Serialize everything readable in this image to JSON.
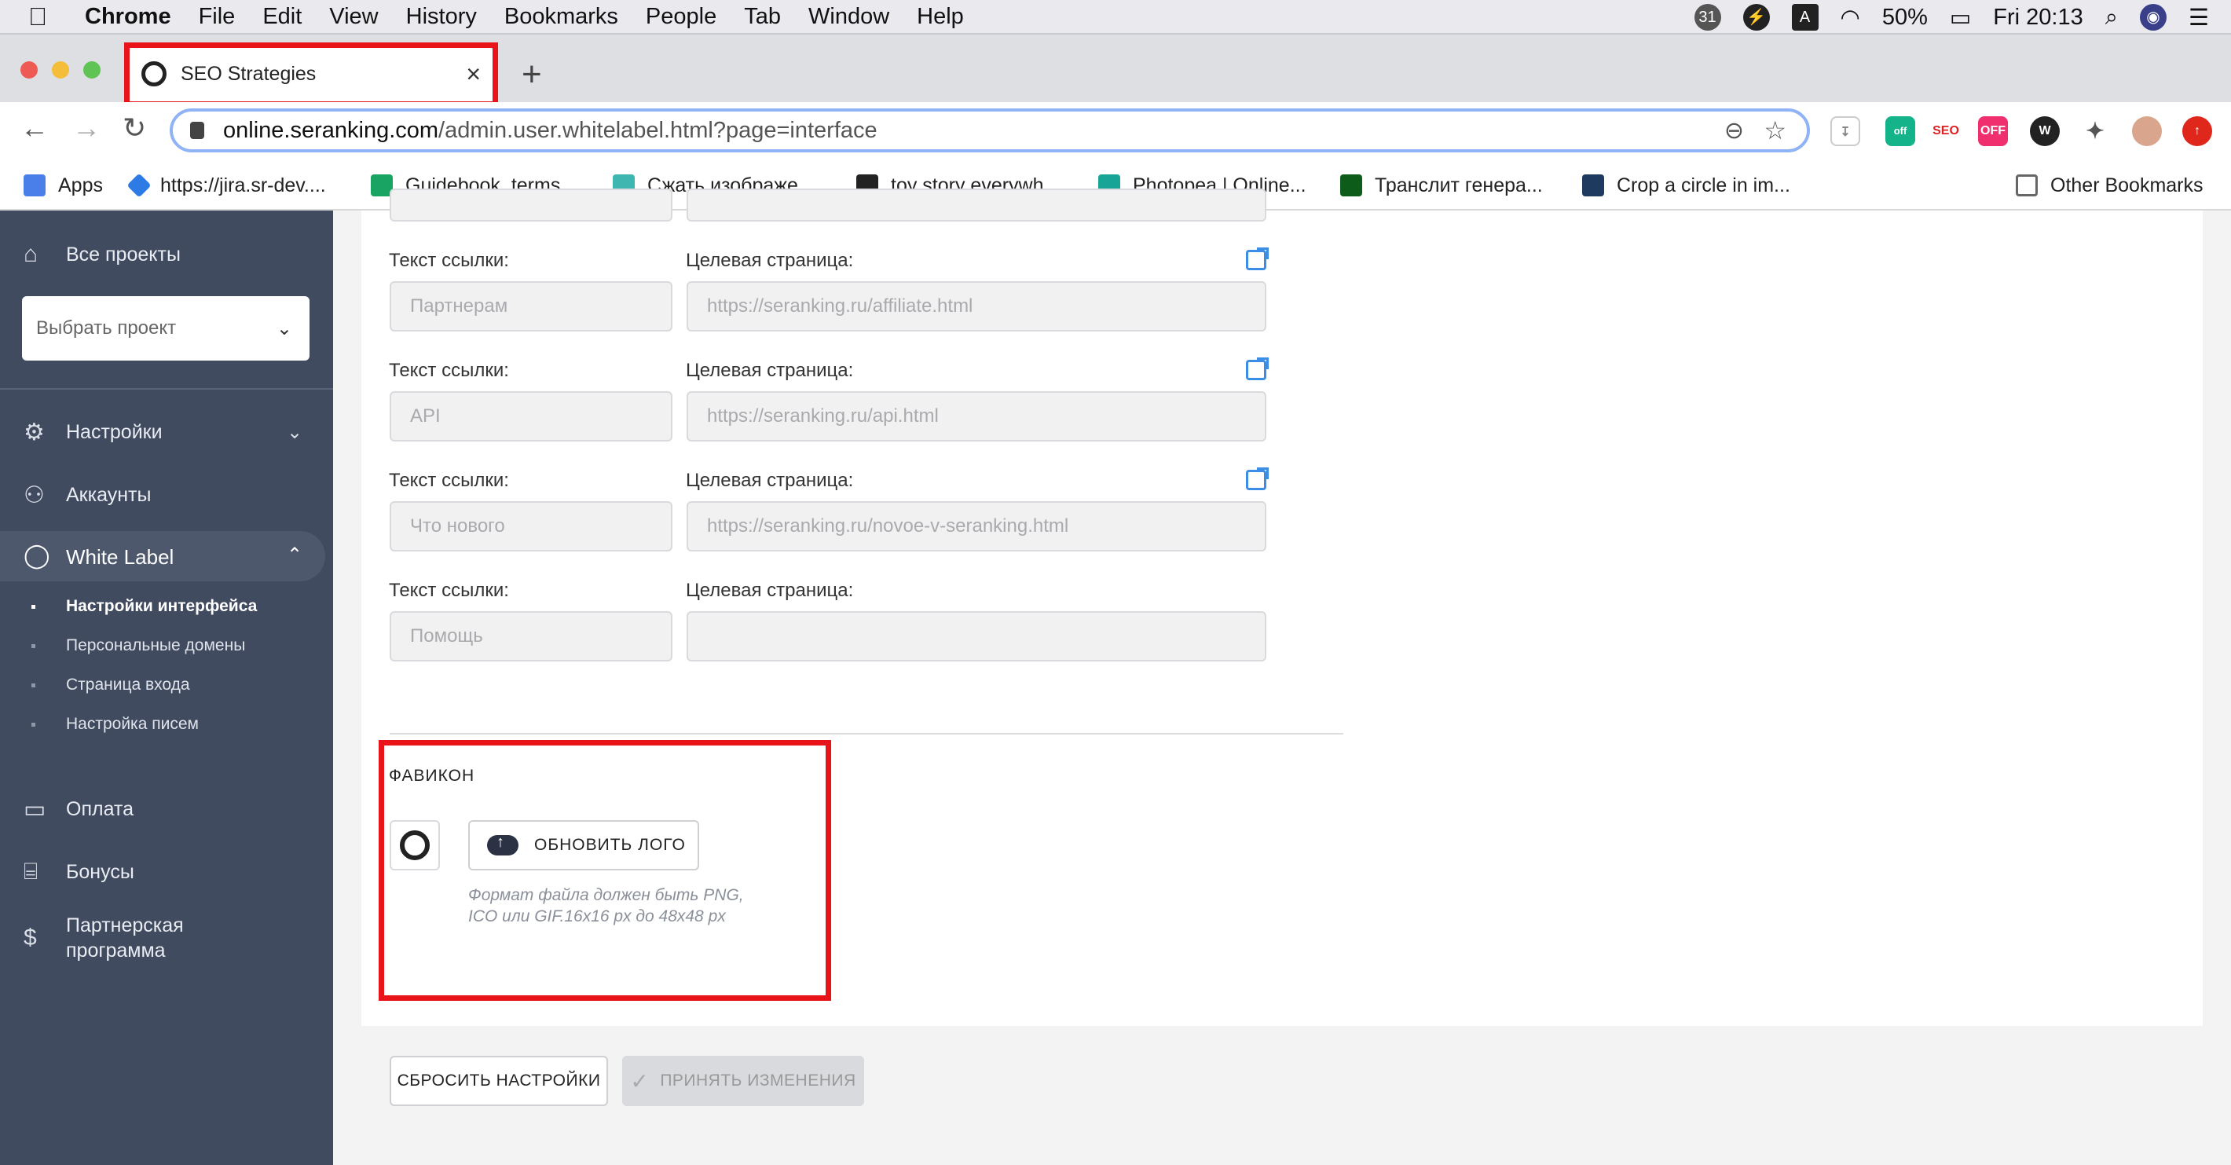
{
  "menubar": {
    "app": "Chrome",
    "items": [
      "File",
      "Edit",
      "View",
      "History",
      "Bookmarks",
      "People",
      "Tab",
      "Window",
      "Help"
    ],
    "battery": "50%",
    "clock": "Fri 20:13",
    "badge": "31"
  },
  "tab": {
    "title": "SEO Strategies",
    "close": "×",
    "new": "+"
  },
  "omnibox": {
    "domain": "online.seranking.com",
    "path": "/admin.user.whitelabel.html?page=interface"
  },
  "extensions": {
    "grammarly_badge": "off",
    "seo": "SEO",
    "lt": "OFF"
  },
  "bookmarks": {
    "items": [
      "Apps",
      "https://jira.sr-dev....",
      "Guidebook, terms,...",
      "Сжать изображе...",
      "toy story everywh...",
      "Photopea | Online...",
      "Транслит генера...",
      "Crop a circle in im..."
    ],
    "other": "Other Bookmarks"
  },
  "sidebar": {
    "all_projects": "Все проекты",
    "select_placeholder": "Выбрать проект",
    "settings": "Настройки",
    "accounts": "Аккаунты",
    "white_label": "White Label",
    "sub": [
      "Настройки интерфейса",
      "Персональные домены",
      "Страница входа",
      "Настройка писем"
    ],
    "billing": "Оплата",
    "bonuses": "Бонусы",
    "partner": "Партнерская программа"
  },
  "links": [
    {
      "text_label": "Текст ссылки:",
      "target_label": "Целевая страница:",
      "text": "Партнерам",
      "url": "https://seranking.ru/affiliate.html"
    },
    {
      "text_label": "Текст ссылки:",
      "target_label": "Целевая страница:",
      "text": "API",
      "url": "https://seranking.ru/api.html"
    },
    {
      "text_label": "Текст ссылки:",
      "target_label": "Целевая страница:",
      "text": "Что нового",
      "url": "https://seranking.ru/novoe-v-seranking.html"
    },
    {
      "text_label": "Текст ссылки:",
      "target_label": "Целевая страница:",
      "text": "Помощь",
      "url": ""
    }
  ],
  "favicon": {
    "title": "ФАВИКОН",
    "upload_button": "ОБНОВИТЬ ЛОГО",
    "hint": "Формат файла должен быть PNG, ICO или GIF.16x16 px до 48x48 px"
  },
  "actions": {
    "reset": "СБРОСИТЬ НАСТРОЙКИ",
    "apply": "ПРИНЯТЬ ИЗМЕНЕНИЯ"
  },
  "colors": {
    "sidebar": "#414b60",
    "highlight": "#e8141a",
    "link_icon": "#3b8de6"
  }
}
